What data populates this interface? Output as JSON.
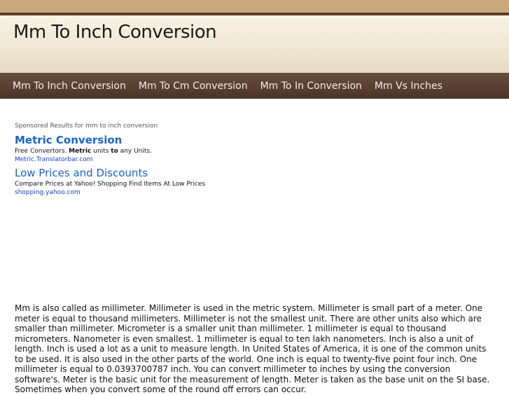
{
  "header": {
    "title": "Mm To Inch Conversion"
  },
  "nav": {
    "items": [
      {
        "label": "Mm To Inch Conversion"
      },
      {
        "label": "Mm To Cm Conversion"
      },
      {
        "label": "Mm To In Conversion"
      },
      {
        "label": "Mm Vs Inches"
      }
    ]
  },
  "ads": {
    "label": "Sponsored Results for mm to inch conversion",
    "items": [
      {
        "title": "Metric Conversion",
        "desc_pre": "Free Convertors. ",
        "desc_bold1": "Metric",
        "desc_mid": " units ",
        "desc_bold2": "to",
        "desc_post": " any Units.",
        "url": "Metric.Translatorbar.com"
      },
      {
        "title": "Low Prices and Discounts",
        "desc": "Compare Prices at Yahoo! Shopping Find Items At Low Prices",
        "url": "shopping.yahoo.com"
      }
    ]
  },
  "article": {
    "text": "Mm is also called as millimeter. Millimeter is used in the metric system. Millimeter is small part of a meter. One meter is equal to thousand millimeters. Millimeter is not the smallest unit. There are other units also which are smaller than millimeter. Micrometer is a smaller unit than millimeter. 1 millimeter is equal to thousand micrometers. Nanometer is even smallest. 1 millimeter is equal to ten lakh nanometers. Inch is also a unit of length. Inch is used a lot as a unit to measure length. In United States of America, it is one of the common units to be used. It is also used in the other parts of the world. One inch is equal to twenty-five point four inch. One millimeter is equal to 0.0393700787 inch. You can convert millimeter to inches by using the conversion software's. Meter is the basic unit for the measurement of length. Meter is taken as the base unit on the SI base. Sometimes when you convert some of the round off errors can occur."
  }
}
